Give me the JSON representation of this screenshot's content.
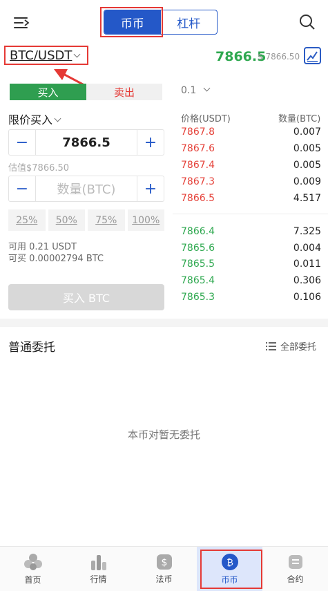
{
  "header": {
    "tabs": [
      "币币",
      "杠杆"
    ],
    "active_tab": "币币"
  },
  "ticker": {
    "pair": "BTC/USDT",
    "last_price": "7866.5",
    "last_price_cny": "$ 7866.50"
  },
  "trade": {
    "buy_tab": "买入",
    "sell_tab": "卖出",
    "order_type": "限价买入",
    "price_value": "7866.5",
    "valuation": "估值$7866.50",
    "amount_placeholder": "数量(BTC)",
    "percent_options": [
      "25%",
      "50%",
      "75%",
      "100%"
    ],
    "available": "可用  0.21 USDT",
    "can_buy": "可买  0.00002794 BTC",
    "submit_label": "买入 BTC"
  },
  "orderbook": {
    "depth": "0.1",
    "price_header": "价格(USDT)",
    "qty_header": "数量(BTC)",
    "asks": [
      {
        "price": "7867.8",
        "qty": "0.007"
      },
      {
        "price": "7867.6",
        "qty": "0.005"
      },
      {
        "price": "7867.4",
        "qty": "0.005"
      },
      {
        "price": "7867.3",
        "qty": "0.009"
      },
      {
        "price": "7866.5",
        "qty": "4.517"
      }
    ],
    "bids": [
      {
        "price": "7866.4",
        "qty": "7.325"
      },
      {
        "price": "7865.6",
        "qty": "0.004"
      },
      {
        "price": "7865.5",
        "qty": "0.011"
      },
      {
        "price": "7865.4",
        "qty": "0.306"
      },
      {
        "price": "7865.3",
        "qty": "0.106"
      }
    ]
  },
  "orders": {
    "title": "普通委托",
    "all_label": "全部委托",
    "empty_text": "本币对暂无委托"
  },
  "nav": [
    {
      "label": "首页",
      "icon": "home-icon"
    },
    {
      "label": "行情",
      "icon": "market-icon"
    },
    {
      "label": "法币",
      "icon": "fiat-icon"
    },
    {
      "label": "币币",
      "icon": "bitcoin-icon"
    },
    {
      "label": "合约",
      "icon": "contract-icon"
    }
  ],
  "colors": {
    "accent": "#2458c8",
    "green": "#2ea84f",
    "red": "#e5423a",
    "annotation": "#e53935"
  }
}
